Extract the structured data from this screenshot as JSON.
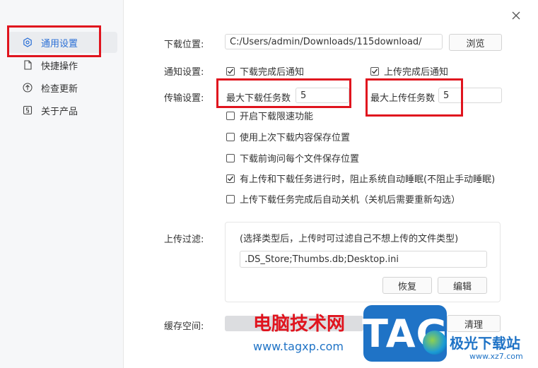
{
  "sidebar": {
    "items": [
      {
        "label": "通用设置",
        "icon": "settings-icon"
      },
      {
        "label": "快捷操作",
        "icon": "file-icon"
      },
      {
        "label": "检查更新",
        "icon": "upload-circle-icon"
      },
      {
        "label": "关于产品",
        "icon": "info-box-icon"
      }
    ]
  },
  "download": {
    "label": "下载位置:",
    "path": "C:/Users/admin/Downloads/115download/",
    "browse": "浏览"
  },
  "notify": {
    "label": "通知设置:",
    "download_done": "下载完成后通知",
    "upload_done": "上传完成后通知"
  },
  "transfer": {
    "label": "传输设置:",
    "max_download_label": "最大下载任务数",
    "max_download_value": "5",
    "max_upload_label": "最大上传任务数",
    "max_upload_value": "5",
    "options": [
      {
        "text": "开启下载限速功能",
        "checked": false
      },
      {
        "text": "使用上次下载内容保存位置",
        "checked": false
      },
      {
        "text": "下载前询问每个文件保存位置",
        "checked": false
      },
      {
        "text": "有上传和下载任务进行时，阻止系统自动睡眠(不阻止手动睡眠)",
        "checked": true
      },
      {
        "text": "上传下载任务完成后自动关机（关机后需要重新勾选）",
        "checked": false
      }
    ]
  },
  "filter": {
    "label": "上传过滤:",
    "hint": "(选择类型后，上传时可过滤自己不想上传的文件类型)",
    "value": ".DS_Store;Thumbs.db;Desktop.ini",
    "restore": "恢复",
    "edit": "编辑"
  },
  "cache": {
    "label": "缓存空间:",
    "clear": "清理"
  },
  "watermark": {
    "site_name": "电脑技术网",
    "site_url": "www.tagxp.com",
    "logo": "TAG",
    "brand": "极光下载站",
    "brand_url": "www.xz7.com"
  },
  "colors": {
    "accent": "#2a6fd6",
    "highlight": "#e0141e"
  }
}
